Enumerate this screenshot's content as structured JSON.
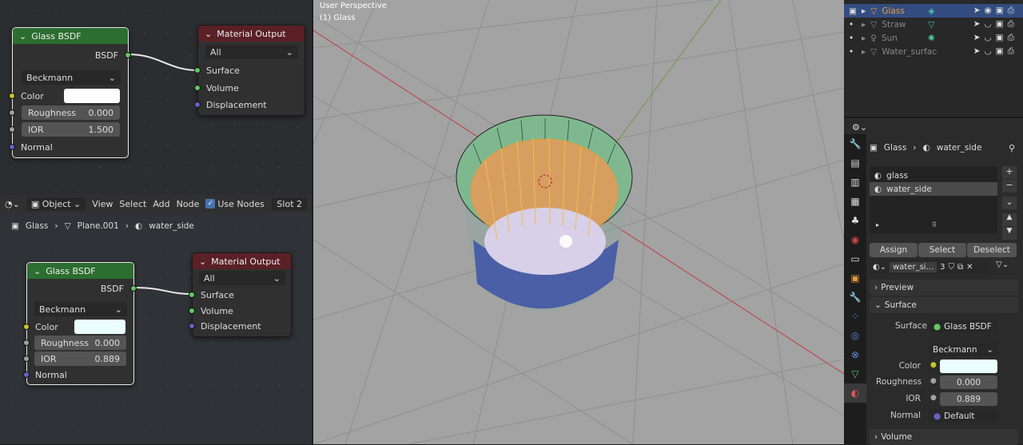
{
  "node_editor_top": {
    "glass_node": {
      "title": "Glass BSDF",
      "output": "BSDF",
      "distribution": "Beckmann",
      "color_label": "Color",
      "roughness_label": "Roughness",
      "roughness": "0.000",
      "ior_label": "IOR",
      "ior": "1.500",
      "normal_label": "Normal",
      "color_hex": "#ffffff"
    },
    "output_node": {
      "title": "Material Output",
      "target": "All",
      "surface": "Surface",
      "volume": "Volume",
      "displacement": "Displacement"
    }
  },
  "node_editor_header": {
    "mode": "Object",
    "view": "View",
    "select": "Select",
    "add": "Add",
    "node": "Node",
    "use_nodes": "Use Nodes",
    "slot": "Slot 2"
  },
  "breadcrumb": {
    "object": "Glass",
    "mesh": "Plane.001",
    "material": "water_side"
  },
  "node_editor_bottom": {
    "glass_node": {
      "title": "Glass BSDF",
      "output": "BSDF",
      "distribution": "Beckmann",
      "color_label": "Color",
      "roughness_label": "Roughness",
      "roughness": "0.000",
      "ior_label": "IOR",
      "ior": "0.889",
      "normal_label": "Normal",
      "color_hex": "#eaffff"
    },
    "output_node": {
      "title": "Material Output",
      "target": "All",
      "surface": "Surface",
      "volume": "Volume",
      "displacement": "Displacement"
    }
  },
  "viewport": {
    "perspective": "User Perspective",
    "object": "(1) Glass"
  },
  "outliner": {
    "items": [
      {
        "name": "Glass",
        "selected": true
      },
      {
        "name": "Straw",
        "selected": false
      },
      {
        "name": "Sun",
        "selected": false
      },
      {
        "name": "Water_surface",
        "selected": false
      }
    ]
  },
  "properties": {
    "crumb_object": "Glass",
    "crumb_material": "water_side",
    "slots": [
      "glass",
      "water_side"
    ],
    "assign": "Assign",
    "select": "Select",
    "deselect": "Deselect",
    "material_name": "water_si...",
    "users": "3",
    "preview": "Preview",
    "surface_section": "Surface",
    "surface_label": "Surface",
    "surface_value": "Glass BSDF",
    "distribution": "Beckmann",
    "color_label": "Color",
    "color_hex": "#eaffff",
    "roughness_label": "Roughness",
    "roughness": "0.000",
    "ior_label": "IOR",
    "ior": "0.889",
    "normal_label": "Normal",
    "normal_value": "Default",
    "volume_section": "Volume"
  },
  "colors": {
    "accent": "#4772b3",
    "shader_header": "#2c6d30",
    "output_header": "#5a2026",
    "socket_shader": "#63c763",
    "socket_color": "#c7c729"
  }
}
